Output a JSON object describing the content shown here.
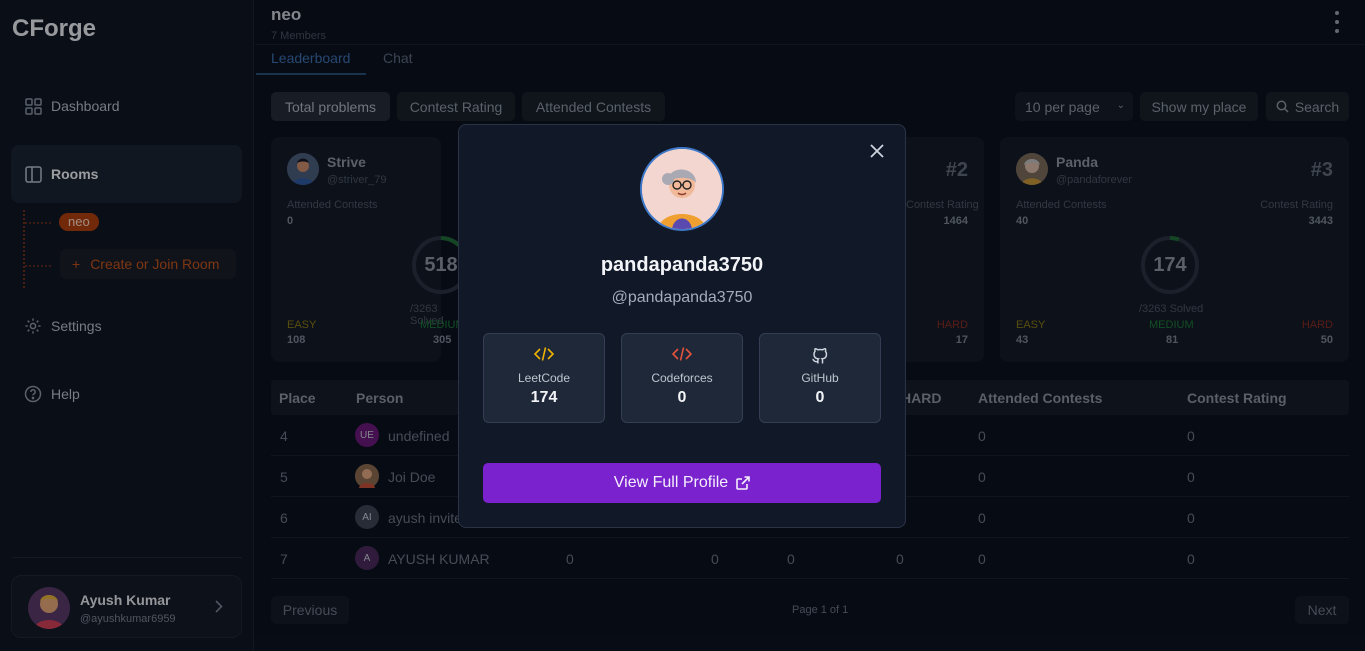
{
  "app": {
    "logo": "CForge"
  },
  "sidebar": {
    "items": [
      {
        "label": "Dashboard",
        "icon": "dashboard-icon"
      },
      {
        "label": "Rooms",
        "icon": "rooms-icon"
      },
      {
        "label": "Settings",
        "icon": "gear-icon"
      },
      {
        "label": "Help",
        "icon": "help-icon"
      }
    ],
    "room_badge": "neo",
    "create_room": "Create or Join Room",
    "user": {
      "name": "Ayush Kumar",
      "handle": "@ayushkumar6959"
    }
  },
  "room": {
    "title": "neo",
    "members": "7 Members",
    "tabs": [
      "Leaderboard",
      "Chat"
    ]
  },
  "filters": {
    "sort_options": [
      "Total problems",
      "Contest Rating",
      "Attended Contests"
    ],
    "per_page": "10 per page",
    "show_my_place": "Show my place",
    "search": "Search"
  },
  "cards": [
    {
      "name": "Strive",
      "handle": "@striver_79",
      "rank": "",
      "attended_label": "Attended Contests",
      "attended": "0",
      "rating_label": "",
      "rating": "",
      "total": "518",
      "solved": "/3263 Solved",
      "easy_label": "EASY",
      "easy": "108",
      "medium_label": "MEDIUM",
      "medium": "305",
      "hard_label": "",
      "hard": ""
    },
    {
      "name": "",
      "handle": "",
      "rank": "#2",
      "attended_label": "",
      "attended": "",
      "rating_label": "Contest Rating",
      "rating": "1464",
      "total": "",
      "solved": "",
      "easy_label": "",
      "easy": "",
      "medium_label": "",
      "medium": "",
      "hard_label": "HARD",
      "hard": "17"
    },
    {
      "name": "Panda",
      "handle": "@pandaforever",
      "rank": "#3",
      "attended_label": "Attended Contests",
      "attended": "40",
      "rating_label": "Contest Rating",
      "rating": "3443",
      "total": "174",
      "solved": "/3263 Solved",
      "easy_label": "EASY",
      "easy": "43",
      "medium_label": "MEDIUM",
      "medium": "81",
      "hard_label": "HARD",
      "hard": "50"
    }
  ],
  "table": {
    "headers": [
      "Place",
      "Person",
      "HARD",
      "Attended Contests",
      "Contest Rating"
    ],
    "rows": [
      {
        "place": "4",
        "initials": "UE",
        "person": "undefined",
        "easy": "",
        "medium": "",
        "hard": "",
        "attended": "0",
        "rating": "0",
        "avatar_color": "#6a1a7a"
      },
      {
        "place": "5",
        "initials": "",
        "person": "Joi Doe",
        "easy": "",
        "medium": "",
        "hard": "",
        "attended": "0",
        "rating": "0",
        "avatar_color": "#6b5240"
      },
      {
        "place": "6",
        "initials": "AI",
        "person": "ayush invite",
        "easy": "",
        "medium": "",
        "hard": "",
        "attended": "0",
        "rating": "0",
        "avatar_color": "#3c4453"
      },
      {
        "place": "7",
        "initials": "A",
        "person": "AYUSH KUMAR",
        "total": "0",
        "easy": "0",
        "medium": "0",
        "hard": "0",
        "attended": "0",
        "rating": "0",
        "avatar_color": "#4b2a5e"
      }
    ]
  },
  "pagination": {
    "previous": "Previous",
    "page_text": "Page 1 of 1",
    "next": "Next"
  },
  "modal": {
    "name": "pandapanda3750",
    "handle": "@pandapanda3750",
    "platforms": [
      {
        "name": "LeetCode",
        "value": "174",
        "icon": "code-icon",
        "color": "#f0b400"
      },
      {
        "name": "Codeforces",
        "value": "0",
        "icon": "code-icon",
        "color": "#e5533d"
      },
      {
        "name": "GitHub",
        "value": "0",
        "icon": "github-icon",
        "color": "#cfd5de"
      }
    ],
    "view_profile": "View Full Profile",
    "button_color": "#7b22cf"
  },
  "colors": {
    "easy": "#8a7a14",
    "medium": "#1c7a3a",
    "hard": "#8a2c24",
    "accent": "#7b22cf"
  }
}
